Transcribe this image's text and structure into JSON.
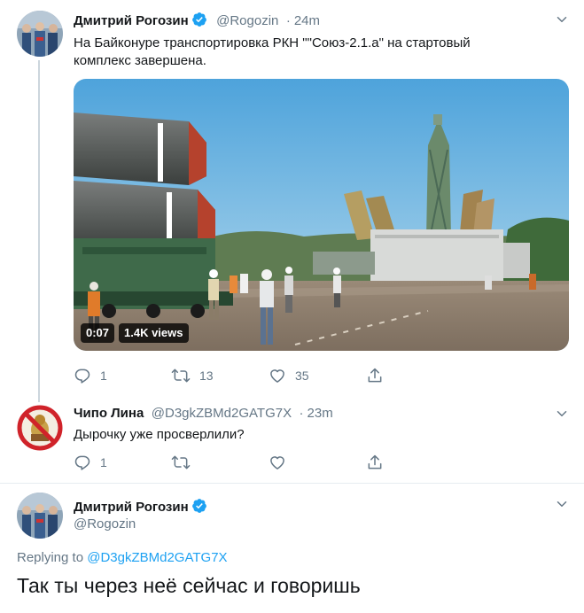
{
  "tweet1": {
    "author_name": "Дмитрий Рогозин",
    "handle": "@Rogozin",
    "separator": "·",
    "time": "24m",
    "text_line1": "На Байконуре транспортировка РКН \"\"Союз-2.1.а\" на стартовый",
    "text_line2": "комплекс завершена.",
    "video_duration": "0:07",
    "video_views": "1.4K views",
    "reply_count": "1",
    "retweet_count": "13",
    "like_count": "35"
  },
  "tweet2": {
    "author_name": "Чипо Лина",
    "handle": "@D3gkZBMd2GATG7X",
    "separator": "·",
    "time": "23m",
    "text": "Дырочку уже просверлили?",
    "reply_count": "1"
  },
  "tweet3": {
    "author_name": "Дмитрий Рогозин",
    "handle": "@Rogozin",
    "replying_prefix": "Replying to",
    "replying_handle": "@D3gkZBMd2GATG7X",
    "text": "Так ты через неё сейчас и говоришь"
  },
  "colors": {
    "accent": "#1da1f2",
    "secondary_text": "#657786",
    "primary_text": "#14171a",
    "thread_line": "#ccd6dd"
  },
  "icons": {
    "verified": "verified-badge-icon",
    "caret": "chevron-down-icon",
    "reply": "reply-icon",
    "retweet": "retweet-icon",
    "like": "heart-icon",
    "share": "share-icon"
  }
}
